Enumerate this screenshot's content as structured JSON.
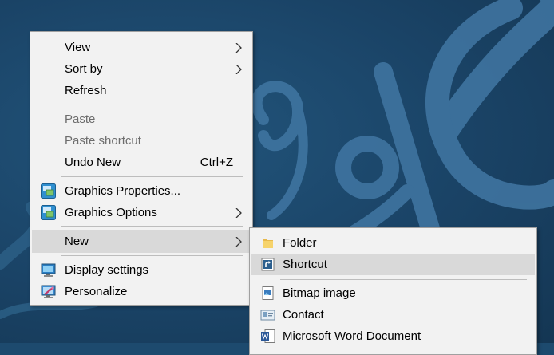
{
  "context_menu": {
    "items": [
      {
        "label": "View",
        "icon": "",
        "submenu": true
      },
      {
        "label": "Sort by",
        "icon": "",
        "submenu": true
      },
      {
        "label": "Refresh",
        "icon": ""
      },
      {
        "label": "Paste",
        "disabled": true
      },
      {
        "label": "Paste shortcut",
        "disabled": true
      },
      {
        "label": "Undo New",
        "shortcut": "Ctrl+Z"
      },
      {
        "label": "Graphics Properties...",
        "icon": "intel-graphics-icon"
      },
      {
        "label": "Graphics Options",
        "icon": "intel-graphics-icon",
        "submenu": true
      },
      {
        "label": "New",
        "submenu": true,
        "highlighted": true
      },
      {
        "label": "Display settings",
        "icon": "display-settings-icon"
      },
      {
        "label": "Personalize",
        "icon": "personalize-icon"
      }
    ]
  },
  "new_submenu": {
    "items": [
      {
        "label": "Folder",
        "icon": "folder-icon"
      },
      {
        "label": "Shortcut",
        "icon": "shortcut-icon",
        "highlighted": true
      },
      {
        "label": "Bitmap image",
        "icon": "bitmap-icon"
      },
      {
        "label": "Contact",
        "icon": "contact-icon"
      },
      {
        "label": "Microsoft Word Document",
        "icon": "word-icon"
      }
    ]
  },
  "colors": {
    "desktop_bg": "#1d4a6e",
    "menu_bg": "#f2f2f2",
    "highlight": "#d9d9d9",
    "disabled_text": "#6d6d6d"
  }
}
